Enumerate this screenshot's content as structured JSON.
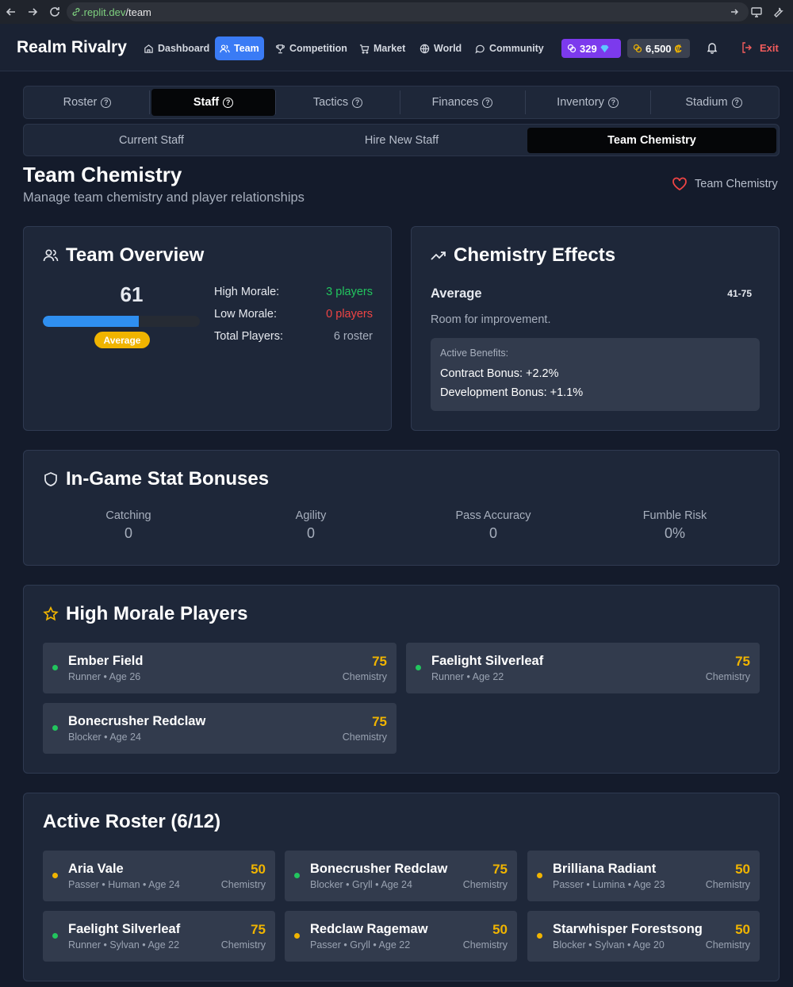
{
  "browser": {
    "url_host": ".replit.dev",
    "url_path": "/team"
  },
  "header": {
    "brand": "Realm Rivalry",
    "nav": [
      "Dashboard",
      "Team",
      "Competition",
      "Market",
      "World",
      "Community"
    ],
    "gems": "329",
    "coins": "6,500",
    "coin_symbol": "₡",
    "exit": "Exit"
  },
  "tabs": [
    "Roster",
    "Staff",
    "Tactics",
    "Finances",
    "Inventory",
    "Stadium"
  ],
  "subtabs": [
    "Current Staff",
    "Hire New Staff",
    "Team Chemistry"
  ],
  "page": {
    "title": "Team Chemistry",
    "subtitle": "Manage team chemistry and player relationships",
    "badge": "Team Chemistry"
  },
  "overview": {
    "title": "Team Overview",
    "score": "61",
    "score_fraction": 0.61,
    "level": "Average",
    "rows": [
      {
        "label": "High Morale:",
        "value": "3 players"
      },
      {
        "label": "Low Morale:",
        "value": "0 players"
      },
      {
        "label": "Total Players:",
        "value": "6 roster"
      }
    ]
  },
  "effects": {
    "title": "Chemistry Effects",
    "level": "Average",
    "range": "41-75",
    "description": "Room for improvement.",
    "benefits_title": "Active Benefits:",
    "benefits": [
      "Contract Bonus: +2.2%",
      "Development Bonus: +1.1%"
    ]
  },
  "stats": {
    "title": "In-Game Stat Bonuses",
    "items": [
      {
        "label": "Catching",
        "value": "0"
      },
      {
        "label": "Agility",
        "value": "0"
      },
      {
        "label": "Pass Accuracy",
        "value": "0"
      },
      {
        "label": "Fumble Risk",
        "value": "0%"
      }
    ]
  },
  "high_morale": {
    "title": "High Morale Players",
    "players": [
      {
        "name": "Ember Field",
        "meta": "Runner • Age 26",
        "score": "75",
        "unit": "Chemistry"
      },
      {
        "name": "Faelight Silverleaf",
        "meta": "Runner • Age 22",
        "score": "75",
        "unit": "Chemistry"
      },
      {
        "name": "Bonecrusher Redclaw",
        "meta": "Blocker • Age 24",
        "score": "75",
        "unit": "Chemistry"
      }
    ]
  },
  "roster": {
    "title": "Active Roster (6/12)",
    "players": [
      {
        "name": "Aria Vale",
        "meta": "Passer • Human • Age 24",
        "score": "50",
        "unit": "Chemistry",
        "status_color": "#f0b400"
      },
      {
        "name": "Bonecrusher Redclaw",
        "meta": "Blocker • Gryll • Age 24",
        "score": "75",
        "unit": "Chemistry",
        "status_color": "#22c55e"
      },
      {
        "name": "Brilliana Radiant",
        "meta": "Passer • Lumina • Age 23",
        "score": "50",
        "unit": "Chemistry",
        "status_color": "#f0b400"
      },
      {
        "name": "Faelight Silverleaf",
        "meta": "Runner • Sylvan • Age 22",
        "score": "75",
        "unit": "Chemistry",
        "status_color": "#22c55e"
      },
      {
        "name": "Redclaw Ragemaw",
        "meta": "Passer • Gryll • Age 22",
        "score": "50",
        "unit": "Chemistry",
        "status_color": "#f0b400"
      },
      {
        "name": "Starwhisper Forestsong",
        "meta": "Blocker • Sylvan • Age 20",
        "score": "50",
        "unit": "Chemistry",
        "status_color": "#f0b400"
      }
    ]
  }
}
